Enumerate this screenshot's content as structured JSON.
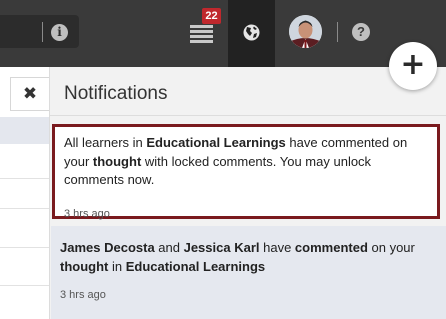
{
  "topbar": {
    "notification_count": "22",
    "info_glyph": "i",
    "help_glyph": "?",
    "icons": [
      "info-icon",
      "list-icon",
      "globe-icon",
      "avatar",
      "help-icon"
    ],
    "bg_color": "#3a3a3a",
    "active_tab_color": "#222222",
    "badge_color": "#c0282d"
  },
  "left": {
    "close_glyph": "✖"
  },
  "fab": {
    "plus_glyph": "+"
  },
  "panel": {
    "title": "Notifications",
    "notifications": [
      {
        "parts": [
          {
            "t": "All learners in ",
            "b": false
          },
          {
            "t": "Educational Learnings",
            "b": true
          },
          {
            "t": " have commented on your ",
            "b": false
          },
          {
            "t": "thought",
            "b": true
          },
          {
            "t": " with locked comments. You may unlock comments now.",
            "b": false
          }
        ],
        "time": "3 hrs ago",
        "highlight_border": "#7a1a1e"
      },
      {
        "parts": [
          {
            "t": "James Decosta",
            "b": true
          },
          {
            "t": " and ",
            "b": false
          },
          {
            "t": "Jessica Karl",
            "b": true
          },
          {
            "t": " have ",
            "b": false
          },
          {
            "t": "commented",
            "b": true
          },
          {
            "t": " on your ",
            "b": false
          },
          {
            "t": "thought",
            "b": true
          },
          {
            "t": " in ",
            "b": false
          },
          {
            "t": "Educational Learnings",
            "b": true
          }
        ],
        "time": "3 hrs ago",
        "background": "#e5e8ef"
      }
    ]
  }
}
